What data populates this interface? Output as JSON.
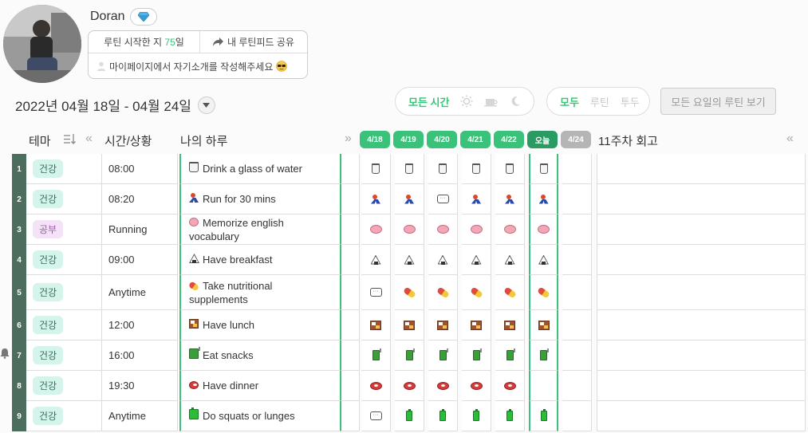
{
  "profile": {
    "username": "Doran",
    "badge_icon": "gem-icon",
    "start_prefix": "루틴 시작한 지 ",
    "start_days": "75",
    "start_suffix": "일",
    "share_label": "내 루틴피드 공유",
    "intro_prompt": "마이페이지에서 자기소개를 작성해주세요"
  },
  "toolbar": {
    "date_range": "2022년 04월 18일 - 04월 24일",
    "time_filter_active": "모든 시간",
    "type_all": "모두",
    "type_routine": "루틴",
    "type_todo": "투두",
    "all_weekday_button": "모든 요일의 루틴 보기"
  },
  "headers": {
    "theme": "테마",
    "time": "시간/상황",
    "my_day": "나의 하루",
    "retro": "11주차 회고"
  },
  "dates": [
    {
      "label": "4/18",
      "state": "past"
    },
    {
      "label": "4/19",
      "state": "past"
    },
    {
      "label": "4/20",
      "state": "past"
    },
    {
      "label": "4/21",
      "state": "past"
    },
    {
      "label": "4/22",
      "state": "past"
    },
    {
      "label": "오늘",
      "state": "today"
    },
    {
      "label": "4/24",
      "state": "future"
    }
  ],
  "rows": [
    {
      "num": "1",
      "theme": "건강",
      "theme_type": "health",
      "time": "08:00",
      "task": "Drink a glass of water",
      "icon": "cup",
      "checks": [
        "cup",
        "cup",
        "cup",
        "cup",
        "cup",
        "cup",
        ""
      ]
    },
    {
      "num": "2",
      "theme": "건강",
      "theme_type": "health",
      "time": "08:20",
      "task": "Run for 30 mins",
      "icon": "runner",
      "checks": [
        "runner",
        "runner",
        "bubble",
        "runner",
        "runner",
        "runner",
        ""
      ]
    },
    {
      "num": "3",
      "theme": "공부",
      "theme_type": "study",
      "time": "Running",
      "task": "Memorize english vocabulary",
      "icon": "brain",
      "checks": [
        "brain",
        "brain",
        "brain",
        "brain",
        "brain",
        "brain",
        ""
      ]
    },
    {
      "num": "4",
      "theme": "건강",
      "theme_type": "health",
      "time": "09:00",
      "task": "Have breakfast",
      "icon": "onigiri",
      "checks": [
        "onigiri",
        "onigiri",
        "onigiri",
        "onigiri",
        "onigiri",
        "onigiri",
        ""
      ]
    },
    {
      "num": "5",
      "theme": "건강",
      "theme_type": "health",
      "time": "Anytime",
      "task": "Take nutritional supplements",
      "icon": "pill",
      "checks": [
        "bubble",
        "pill",
        "pill",
        "pill",
        "pill",
        "pill",
        ""
      ]
    },
    {
      "num": "6",
      "theme": "건강",
      "theme_type": "health",
      "time": "12:00",
      "task": "Have lunch",
      "icon": "bento",
      "checks": [
        "bento",
        "bento",
        "bento",
        "bento",
        "bento",
        "bento",
        ""
      ]
    },
    {
      "num": "7",
      "theme": "건강",
      "theme_type": "health",
      "time": "16:00",
      "task": "Eat snacks",
      "icon": "juice",
      "checks": [
        "juice",
        "juice",
        "juice",
        "juice",
        "juice",
        "juice",
        ""
      ]
    },
    {
      "num": "8",
      "theme": "건강",
      "theme_type": "health",
      "time": "19:30",
      "task": "Have dinner",
      "icon": "meat",
      "checks": [
        "meat",
        "meat",
        "meat",
        "meat",
        "meat",
        "",
        ""
      ]
    },
    {
      "num": "9",
      "theme": "건강",
      "theme_type": "health",
      "time": "Anytime",
      "task": "Do squats or lunges",
      "icon": "battery",
      "checks": [
        "bubble",
        "battery",
        "battery",
        "battery",
        "battery",
        "battery",
        ""
      ]
    }
  ],
  "colors": {
    "accent": "#3ac27a",
    "row_number_bg": "#4d6e5e",
    "today_tag": "#2a9b63",
    "future_tag": "#b5b5b5"
  }
}
